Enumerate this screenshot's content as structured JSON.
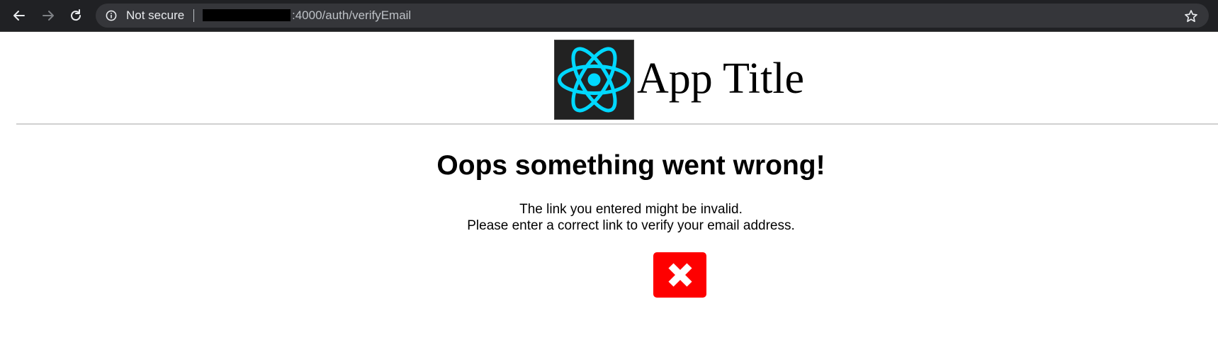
{
  "browser": {
    "security_label": "Not secure",
    "url_path": ":4000/auth/verifyEmail"
  },
  "header": {
    "app_title": "App Title",
    "logo_icon": "react-atom-icon",
    "logo_accent": "#00d8ff",
    "logo_bg": "#222222"
  },
  "main": {
    "heading": "Oops something went wrong!",
    "message_line_1": "The link you entered might be invalid.",
    "message_line_2": "Please enter a correct link to verify your email address.",
    "status_icon": "error-x-icon",
    "status_color": "#fe0000"
  }
}
